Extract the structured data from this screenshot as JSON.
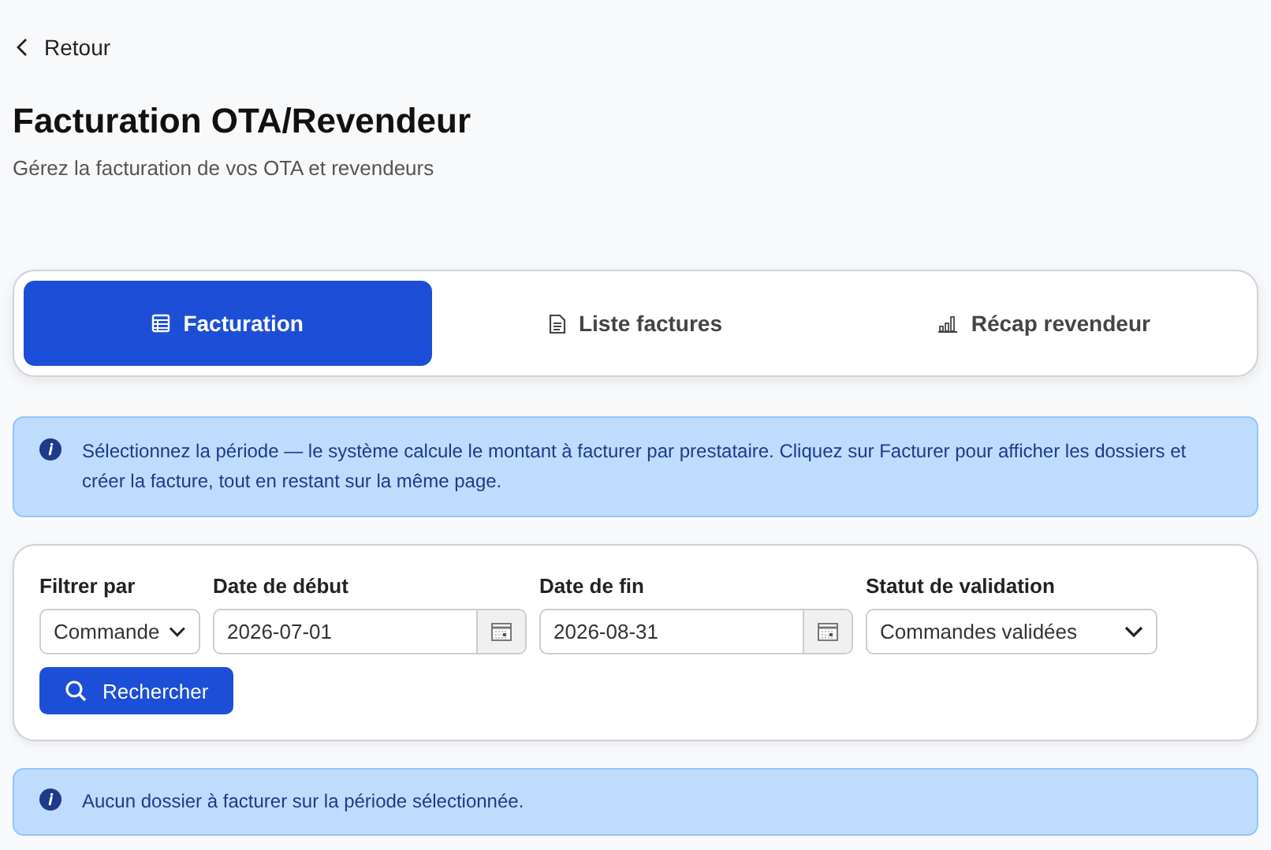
{
  "back_link": "Retour",
  "title": "Facturation OTA/Revendeur",
  "subtitle": "Gérez la facturation de vos OTA et revendeurs",
  "tabs": [
    {
      "label": "Facturation",
      "kind": "table",
      "selected": true
    },
    {
      "label": "Liste factures",
      "kind": "document",
      "selected": false
    },
    {
      "label": "Récap revendeur",
      "kind": "chart",
      "selected": false
    }
  ],
  "info_message": "Sélectionnez la période — le système calcule le montant à facturer par prestataire. Cliquez sur Facturer pour afficher les dossiers et créer la facture, tout en restant sur la même page.",
  "filters": [
    {
      "label": "Filtrer par",
      "kind": "select",
      "value": "Commande"
    },
    {
      "label": "Date de début",
      "kind": "date",
      "value": "2026-07-01"
    },
    {
      "label": "Date de fin",
      "kind": "date",
      "value": "2026-08-31"
    },
    {
      "label": "Statut de validation",
      "kind": "select",
      "value": "Commandes validées"
    }
  ],
  "search_button": "Rechercher",
  "result_message": "Aucun dossier à facturer sur la période sélectionnée."
}
